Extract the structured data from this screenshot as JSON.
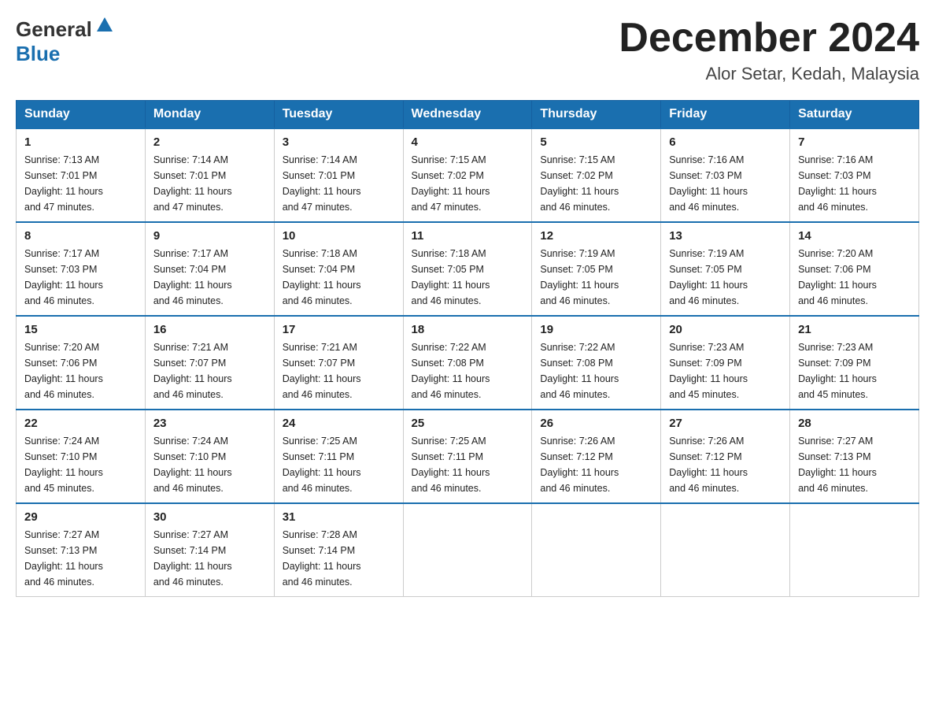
{
  "header": {
    "logo_general": "General",
    "logo_blue": "Blue",
    "month_title": "December 2024",
    "location": "Alor Setar, Kedah, Malaysia"
  },
  "weekdays": [
    "Sunday",
    "Monday",
    "Tuesday",
    "Wednesday",
    "Thursday",
    "Friday",
    "Saturday"
  ],
  "weeks": [
    [
      {
        "day": "1",
        "sunrise": "7:13 AM",
        "sunset": "7:01 PM",
        "daylight": "11 hours and 47 minutes."
      },
      {
        "day": "2",
        "sunrise": "7:14 AM",
        "sunset": "7:01 PM",
        "daylight": "11 hours and 47 minutes."
      },
      {
        "day": "3",
        "sunrise": "7:14 AM",
        "sunset": "7:01 PM",
        "daylight": "11 hours and 47 minutes."
      },
      {
        "day": "4",
        "sunrise": "7:15 AM",
        "sunset": "7:02 PM",
        "daylight": "11 hours and 47 minutes."
      },
      {
        "day": "5",
        "sunrise": "7:15 AM",
        "sunset": "7:02 PM",
        "daylight": "11 hours and 46 minutes."
      },
      {
        "day": "6",
        "sunrise": "7:16 AM",
        "sunset": "7:03 PM",
        "daylight": "11 hours and 46 minutes."
      },
      {
        "day": "7",
        "sunrise": "7:16 AM",
        "sunset": "7:03 PM",
        "daylight": "11 hours and 46 minutes."
      }
    ],
    [
      {
        "day": "8",
        "sunrise": "7:17 AM",
        "sunset": "7:03 PM",
        "daylight": "11 hours and 46 minutes."
      },
      {
        "day": "9",
        "sunrise": "7:17 AM",
        "sunset": "7:04 PM",
        "daylight": "11 hours and 46 minutes."
      },
      {
        "day": "10",
        "sunrise": "7:18 AM",
        "sunset": "7:04 PM",
        "daylight": "11 hours and 46 minutes."
      },
      {
        "day": "11",
        "sunrise": "7:18 AM",
        "sunset": "7:05 PM",
        "daylight": "11 hours and 46 minutes."
      },
      {
        "day": "12",
        "sunrise": "7:19 AM",
        "sunset": "7:05 PM",
        "daylight": "11 hours and 46 minutes."
      },
      {
        "day": "13",
        "sunrise": "7:19 AM",
        "sunset": "7:05 PM",
        "daylight": "11 hours and 46 minutes."
      },
      {
        "day": "14",
        "sunrise": "7:20 AM",
        "sunset": "7:06 PM",
        "daylight": "11 hours and 46 minutes."
      }
    ],
    [
      {
        "day": "15",
        "sunrise": "7:20 AM",
        "sunset": "7:06 PM",
        "daylight": "11 hours and 46 minutes."
      },
      {
        "day": "16",
        "sunrise": "7:21 AM",
        "sunset": "7:07 PM",
        "daylight": "11 hours and 46 minutes."
      },
      {
        "day": "17",
        "sunrise": "7:21 AM",
        "sunset": "7:07 PM",
        "daylight": "11 hours and 46 minutes."
      },
      {
        "day": "18",
        "sunrise": "7:22 AM",
        "sunset": "7:08 PM",
        "daylight": "11 hours and 46 minutes."
      },
      {
        "day": "19",
        "sunrise": "7:22 AM",
        "sunset": "7:08 PM",
        "daylight": "11 hours and 46 minutes."
      },
      {
        "day": "20",
        "sunrise": "7:23 AM",
        "sunset": "7:09 PM",
        "daylight": "11 hours and 45 minutes."
      },
      {
        "day": "21",
        "sunrise": "7:23 AM",
        "sunset": "7:09 PM",
        "daylight": "11 hours and 45 minutes."
      }
    ],
    [
      {
        "day": "22",
        "sunrise": "7:24 AM",
        "sunset": "7:10 PM",
        "daylight": "11 hours and 45 minutes."
      },
      {
        "day": "23",
        "sunrise": "7:24 AM",
        "sunset": "7:10 PM",
        "daylight": "11 hours and 46 minutes."
      },
      {
        "day": "24",
        "sunrise": "7:25 AM",
        "sunset": "7:11 PM",
        "daylight": "11 hours and 46 minutes."
      },
      {
        "day": "25",
        "sunrise": "7:25 AM",
        "sunset": "7:11 PM",
        "daylight": "11 hours and 46 minutes."
      },
      {
        "day": "26",
        "sunrise": "7:26 AM",
        "sunset": "7:12 PM",
        "daylight": "11 hours and 46 minutes."
      },
      {
        "day": "27",
        "sunrise": "7:26 AM",
        "sunset": "7:12 PM",
        "daylight": "11 hours and 46 minutes."
      },
      {
        "day": "28",
        "sunrise": "7:27 AM",
        "sunset": "7:13 PM",
        "daylight": "11 hours and 46 minutes."
      }
    ],
    [
      {
        "day": "29",
        "sunrise": "7:27 AM",
        "sunset": "7:13 PM",
        "daylight": "11 hours and 46 minutes."
      },
      {
        "day": "30",
        "sunrise": "7:27 AM",
        "sunset": "7:14 PM",
        "daylight": "11 hours and 46 minutes."
      },
      {
        "day": "31",
        "sunrise": "7:28 AM",
        "sunset": "7:14 PM",
        "daylight": "11 hours and 46 minutes."
      },
      null,
      null,
      null,
      null
    ]
  ]
}
